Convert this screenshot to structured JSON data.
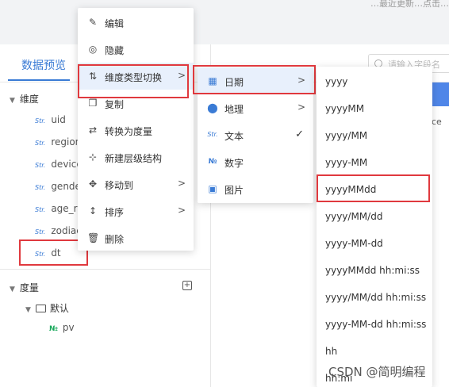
{
  "top_hint": "…最近更新…点击…",
  "left_panel": {
    "tab_preview": "数据预览",
    "dimension_section": "维度",
    "fields": [
      {
        "icon": "Str.",
        "name": "uid"
      },
      {
        "icon": "Str.",
        "name": "region"
      },
      {
        "icon": "Str.",
        "name": "device"
      },
      {
        "icon": "Str.",
        "name": "gender"
      },
      {
        "icon": "Str.",
        "name": "age_ra"
      },
      {
        "icon": "Str.",
        "name": "zodiac"
      },
      {
        "icon": "Str.",
        "name": "dt"
      }
    ],
    "measure_section": "度量",
    "folder_default": "默认",
    "measure_icon": "№",
    "measure_field": "pv"
  },
  "right_area": {
    "search_placeholder": "请输入字段名",
    "cut_text": "ce"
  },
  "menu_main": {
    "items": [
      {
        "icon": "edit-icon",
        "label": "编辑"
      },
      {
        "icon": "eye-hide-icon",
        "label": "隐藏"
      },
      {
        "icon": "sort-swap-icon",
        "label": "维度类型切换",
        "arrow": ">"
      },
      {
        "icon": "copy-icon",
        "label": "复制"
      },
      {
        "icon": "convert-icon",
        "label": "转换为度量"
      },
      {
        "icon": "hierarchy-icon",
        "label": "新建层级结构"
      },
      {
        "icon": "move-icon",
        "label": "移动到",
        "arrow": ">"
      },
      {
        "icon": "sort-icon",
        "label": "排序",
        "arrow": ">"
      },
      {
        "icon": "delete-icon",
        "label": "删除"
      }
    ]
  },
  "menu_type": {
    "items": [
      {
        "icon": "calendar-icon",
        "label": "日期",
        "arrow": ">"
      },
      {
        "icon": "location-icon",
        "label": "地理",
        "arrow": ">"
      },
      {
        "icon": "text-icon",
        "label": "文本",
        "check": "✓"
      },
      {
        "icon": "number-icon",
        "label": "数字"
      },
      {
        "icon": "image-icon",
        "label": "图片"
      }
    ]
  },
  "menu_format": {
    "items": [
      "yyyy",
      "yyyyMM",
      "yyyy/MM",
      "yyyy-MM",
      "yyyyMMdd",
      "yyyy/MM/dd",
      "yyyy-MM-dd",
      "yyyyMMdd hh:mi:ss",
      "yyyy/MM/dd hh:mi:ss",
      "yyyy-MM-dd hh:mi:ss",
      "hh",
      "hh:mi"
    ]
  },
  "watermark": "CSDN @简明编程",
  "colors": {
    "accent": "#3a7bd5",
    "highlight_border": "#e0393e",
    "measure_icon": "#19a85b"
  }
}
